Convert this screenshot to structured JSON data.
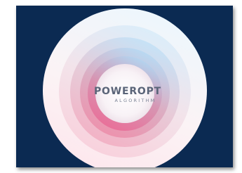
{
  "logo": {
    "title": "POWEROPT",
    "subtitle": "ALGORITHM"
  },
  "colors": {
    "background": "#0b2a52",
    "title": "#5a6478",
    "subtitle": "#7a8294",
    "ring_outer": "#ffffff",
    "ring_pink": "#e85a82",
    "ring_blue": "#a9d2ee"
  }
}
